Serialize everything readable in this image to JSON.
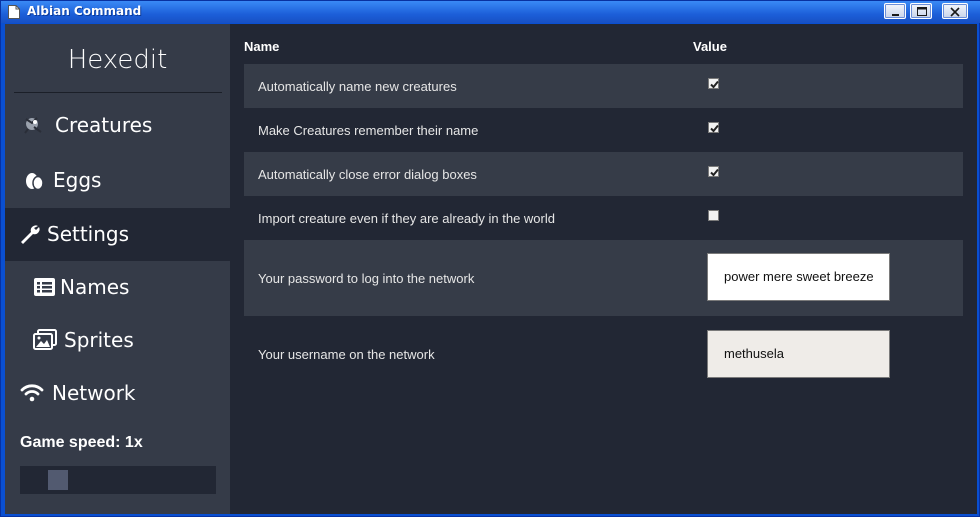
{
  "window": {
    "title": "Albian Command",
    "controls": {
      "minimize": "minimize",
      "maximize": "maximize",
      "close": "close"
    }
  },
  "sidebar": {
    "app_title": "Hexedit",
    "items": [
      {
        "label": "Creatures",
        "icon": "creature-icon",
        "active": false
      },
      {
        "label": "Eggs",
        "icon": "egg-icon",
        "active": false
      },
      {
        "label": "Settings",
        "icon": "wrench-icon",
        "active": true
      },
      {
        "label": "Names",
        "icon": "list-icon",
        "active": false
      },
      {
        "label": "Sprites",
        "icon": "images-icon",
        "active": false
      },
      {
        "label": "Network",
        "icon": "wifi-icon",
        "active": false
      }
    ],
    "game_speed_label": "Game speed: 1x",
    "game_speed_slider_level": 0.18
  },
  "settings": {
    "headers": {
      "name": "Name",
      "value": "Value"
    },
    "rows": [
      {
        "name": "Automatically name new creatures",
        "type": "checkbox",
        "checked": true
      },
      {
        "name": "Make Creatures remember their name",
        "type": "checkbox",
        "checked": true
      },
      {
        "name": "Automatically close error dialog boxes",
        "type": "checkbox",
        "checked": true
      },
      {
        "name": "Import creature even if they are already in the world",
        "type": "checkbox",
        "checked": false
      },
      {
        "name": "Your password to log into the network",
        "type": "text",
        "value": "power mere sweet breeze"
      },
      {
        "name": "Your username on the network",
        "type": "text",
        "value": "methusela"
      }
    ]
  },
  "colors": {
    "sidebar_bg": "#353b48",
    "main_bg": "#222734",
    "row_shade": "#363c48",
    "titlebar": "#1c5fd9"
  }
}
